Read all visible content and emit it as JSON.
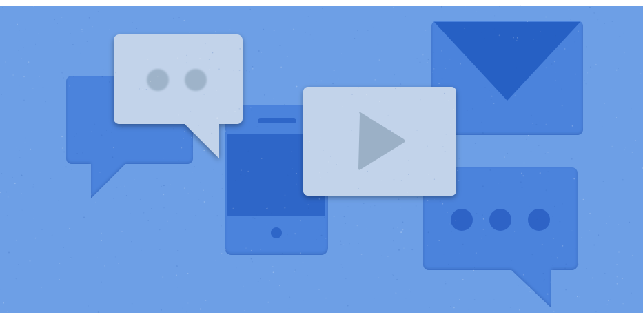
{
  "colors": {
    "background": "#6d9fe6",
    "background_shade": "#6598e0",
    "card_blue": "#4b83dc",
    "card_blue_dark": "#3f76d2",
    "screen_blue": "#2f66c8",
    "envelope_flap": "#2861c4",
    "light_card": "#c2d3ea",
    "light_card_shadow": "#3c6fc7",
    "dot_gray": "#9eb3c9",
    "play_gray": "#9bb0c6",
    "dot_blue": "#2d63c6"
  },
  "icons": [
    "chat-bubble-icon",
    "chat-bubble-two-dots-icon",
    "smartphone-icon",
    "video-play-icon",
    "envelope-icon",
    "chat-bubble-ellipsis-icon"
  ]
}
